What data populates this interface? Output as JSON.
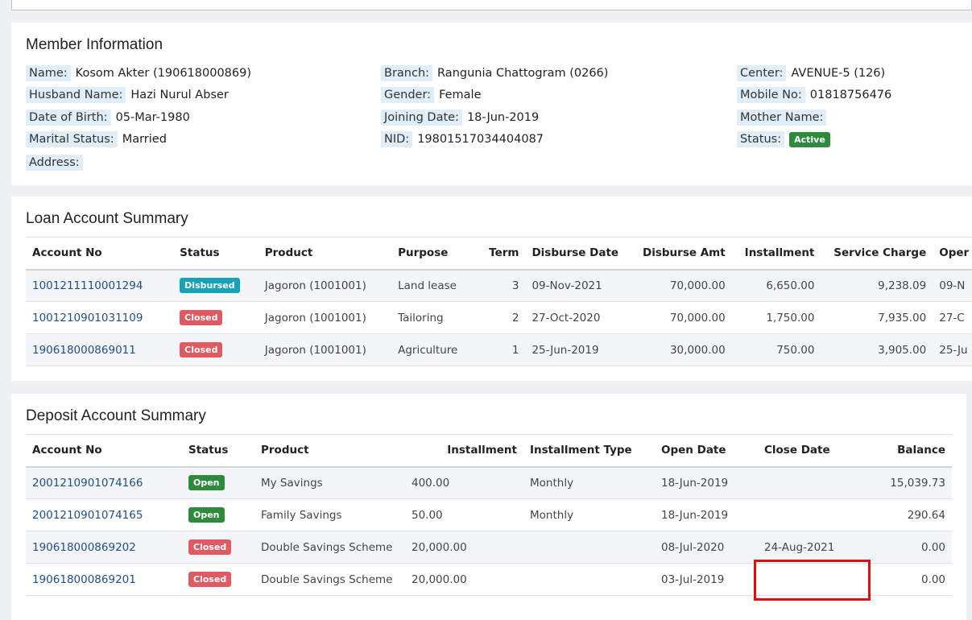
{
  "member": {
    "title": "Member Information",
    "col1": [
      {
        "label": "Name:",
        "value": "Kosom Akter (190618000869)"
      },
      {
        "label": "Husband Name:",
        "value": "Hazi Nurul Abser"
      },
      {
        "label": "Date of Birth:",
        "value": "05-Mar-1980"
      },
      {
        "label": "Marital Status:",
        "value": "Married"
      },
      {
        "label": "Address:",
        "value": ""
      }
    ],
    "col2": [
      {
        "label": "Branch:",
        "value": "Rangunia Chattogram (0266)"
      },
      {
        "label": "Gender:",
        "value": "Female"
      },
      {
        "label": "Joining Date:",
        "value": "18-Jun-2019"
      },
      {
        "label": "NID:",
        "value": "19801517034404087"
      }
    ],
    "col3": [
      {
        "label": "Center:",
        "value": "AVENUE-5 (126)"
      },
      {
        "label": "Mobile No:",
        "value": "01818756476"
      },
      {
        "label": "Mother Name:",
        "value": ""
      },
      {
        "label": "Status:",
        "value": "Active"
      }
    ]
  },
  "loan": {
    "title": "Loan Account Summary",
    "headers": [
      "Account No",
      "Status",
      "Product",
      "Purpose",
      "Term",
      "Disburse Date",
      "Disburse Amt",
      "Installment",
      "Service Charge",
      "Oper"
    ],
    "rows": [
      {
        "account": "1001211110001294",
        "status": "Disbursed",
        "product": "Jagoron (1001001)",
        "purpose": "Land lease",
        "term": "3",
        "disburse_date": "09-Nov-2021",
        "disburse_amt": "70,000.00",
        "installment": "6,650.00",
        "service_charge": "9,238.09",
        "open": "09-N"
      },
      {
        "account": "1001210901031109",
        "status": "Closed",
        "product": "Jagoron (1001001)",
        "purpose": "Tailoring",
        "term": "2",
        "disburse_date": "27-Oct-2020",
        "disburse_amt": "70,000.00",
        "installment": "1,750.00",
        "service_charge": "7,935.00",
        "open": "27-C"
      },
      {
        "account": "190618000869011",
        "status": "Closed",
        "product": "Jagoron (1001001)",
        "purpose": "Agriculture",
        "term": "1",
        "disburse_date": "25-Jun-2019",
        "disburse_amt": "30,000.00",
        "installment": "750.00",
        "service_charge": "3,905.00",
        "open": "25-Ju"
      }
    ]
  },
  "deposit": {
    "title": "Deposit Account Summary",
    "headers": [
      "Account No",
      "Status",
      "Product",
      "Installment",
      "Installment Type",
      "Open Date",
      "Close Date",
      "Balance"
    ],
    "rows": [
      {
        "account": "2001210901074166",
        "status": "Open",
        "product": "My Savings",
        "installment": "400.00",
        "type": "Monthly",
        "open_date": "18-Jun-2019",
        "close_date": "",
        "balance": "15,039.73"
      },
      {
        "account": "2001210901074165",
        "status": "Open",
        "product": "Family Savings",
        "installment": "50.00",
        "type": "Monthly",
        "open_date": "18-Jun-2019",
        "close_date": "",
        "balance": "290.64"
      },
      {
        "account": "190618000869202",
        "status": "Closed",
        "product": "Double Savings Scheme",
        "installment": "20,000.00",
        "type": "",
        "open_date": "08-Jul-2020",
        "close_date": "24-Aug-2021",
        "balance": "0.00"
      },
      {
        "account": "190618000869201",
        "status": "Closed",
        "product": "Double Savings Scheme",
        "installment": "20,000.00",
        "type": "",
        "open_date": "03-Jul-2019",
        "close_date": "",
        "balance": "0.00"
      }
    ]
  },
  "colors": {
    "open": "#2e8b3d",
    "closed": "#e05a62",
    "disbursed": "#17a2b8",
    "highlight": "#e01010"
  }
}
